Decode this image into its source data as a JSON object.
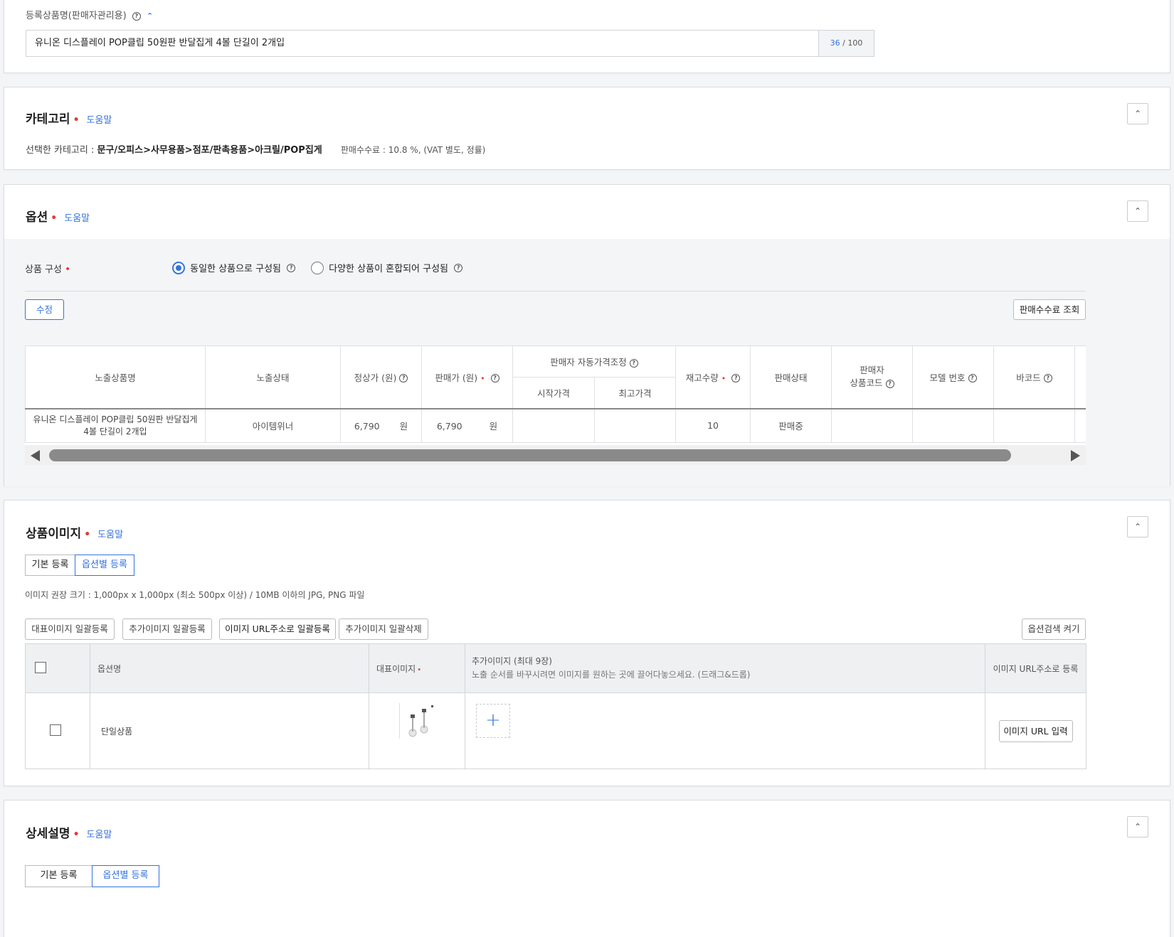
{
  "product_name": {
    "label": "등록상품명(판매자관리용)",
    "value": "유니온 디스플레이 POP클립 50원판 반달집게 4볼 단길이 2개입",
    "count": "36",
    "max": "/ 100"
  },
  "category": {
    "title": "카테고리",
    "help": "도움말",
    "selected_label": "선택한 카테고리 :",
    "selected_path": "문구/오피스>사무용품>점포/판촉용품>아크릴/POP집게",
    "fee": "판매수수료 : 10.8 %, (VAT 별도, 정률)"
  },
  "option": {
    "title": "옵션",
    "help": "도움말",
    "composition_label": "상품 구성",
    "radio_same": "동일한 상품으로 구성됨",
    "radio_mixed": "다양한 상품이 혼합되어 구성됨",
    "edit_button": "수정",
    "fee_button": "판매수수료 조회",
    "headers": {
      "name": "노출상품명",
      "status": "노출상태",
      "regular_price": "정상가 (원)",
      "sale_price": "판매가 (원)",
      "auto_price": "판매자 자동가격조정",
      "start_price": "시작가격",
      "max_price": "최고가격",
      "stock": "재고수량",
      "sale_status": "판매상태",
      "seller_code_1": "판매자",
      "seller_code_2": "상품코드",
      "model": "모델 번호",
      "barcode": "바코드"
    },
    "row": {
      "name_1": "유니온 디스플레이 POP클립 50원판 반달집게",
      "name_2": "4볼 단길이 2개입",
      "status": "아이템위너",
      "regular_price": "6,790",
      "regular_unit": "원",
      "sale_price": "6,790",
      "sale_unit": "원",
      "stock": "10",
      "sale_status": "판매중"
    }
  },
  "images": {
    "title": "상품이미지",
    "help": "도움말",
    "tab_basic": "기본 등록",
    "tab_option": "옵션별 등록",
    "guide": "이미지 권장 크기 : 1,000px x 1,000px (최소 500px 이상) / 10MB 이하의 JPG, PNG 파일",
    "btn_main_bulk": "대표이미지 일괄등록",
    "btn_extra_bulk": "추가이미지 일괄등록",
    "btn_url_bulk": "이미지 URL주소로 일괄등록",
    "btn_extra_delete": "추가이미지 일괄삭제",
    "btn_option_search": "옵션검색 켜기",
    "headers": {
      "option_name": "옵션명",
      "main_image": "대표이미지",
      "extra_image": "추가이미지 (최대 9장)",
      "extra_hint": "노출 순서를 바꾸시려면 이미지를 원하는 곳에 끌어다놓으세요. (드래그&드롭)",
      "url_register": "이미지 URL주소로 등록"
    },
    "row": {
      "option_name": "단일상품",
      "url_button": "이미지 URL 입력"
    }
  },
  "detail": {
    "title": "상세설명",
    "help": "도움말",
    "tab_basic": "기본 등록",
    "tab_option": "옵션별 등록"
  },
  "colors": {
    "accent": "#3472e0",
    "required": "#e53935",
    "scrollbar": "#8a8a8a"
  }
}
